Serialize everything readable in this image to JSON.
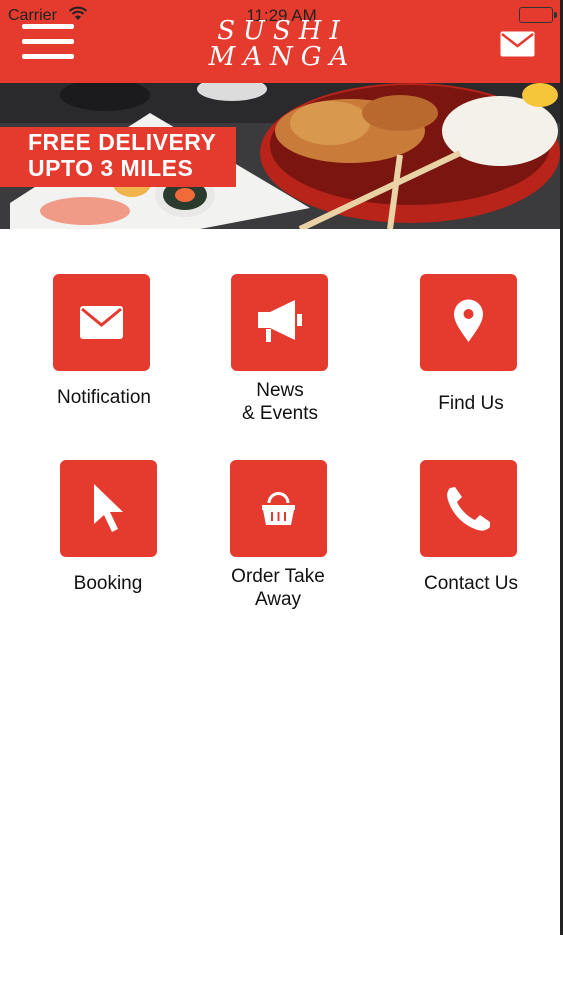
{
  "status_bar": {
    "carrier": "Carrier",
    "time": "11:29 AM"
  },
  "header": {
    "logo_line1": "SUSHI",
    "logo_line2": "MANGA",
    "menu_icon": "hamburger-menu-icon",
    "mail_icon": "envelope-icon"
  },
  "banner": {
    "promo_line1": "FREE DELIVERY",
    "promo_line2": "UPTO 3 MILES"
  },
  "colors": {
    "brand": "#e53b2f",
    "text": "#111111"
  },
  "menu": [
    {
      "label": "Notification",
      "icon": "envelope-icon"
    },
    {
      "label": "News\n& Events",
      "icon": "megaphone-icon"
    },
    {
      "label": "Find Us",
      "icon": "map-pin-icon"
    },
    {
      "label": "Booking",
      "icon": "pointer-icon"
    },
    {
      "label": "Order Take\nAway",
      "icon": "shopping-basket-icon"
    },
    {
      "label": "Contact Us",
      "icon": "phone-icon"
    }
  ]
}
